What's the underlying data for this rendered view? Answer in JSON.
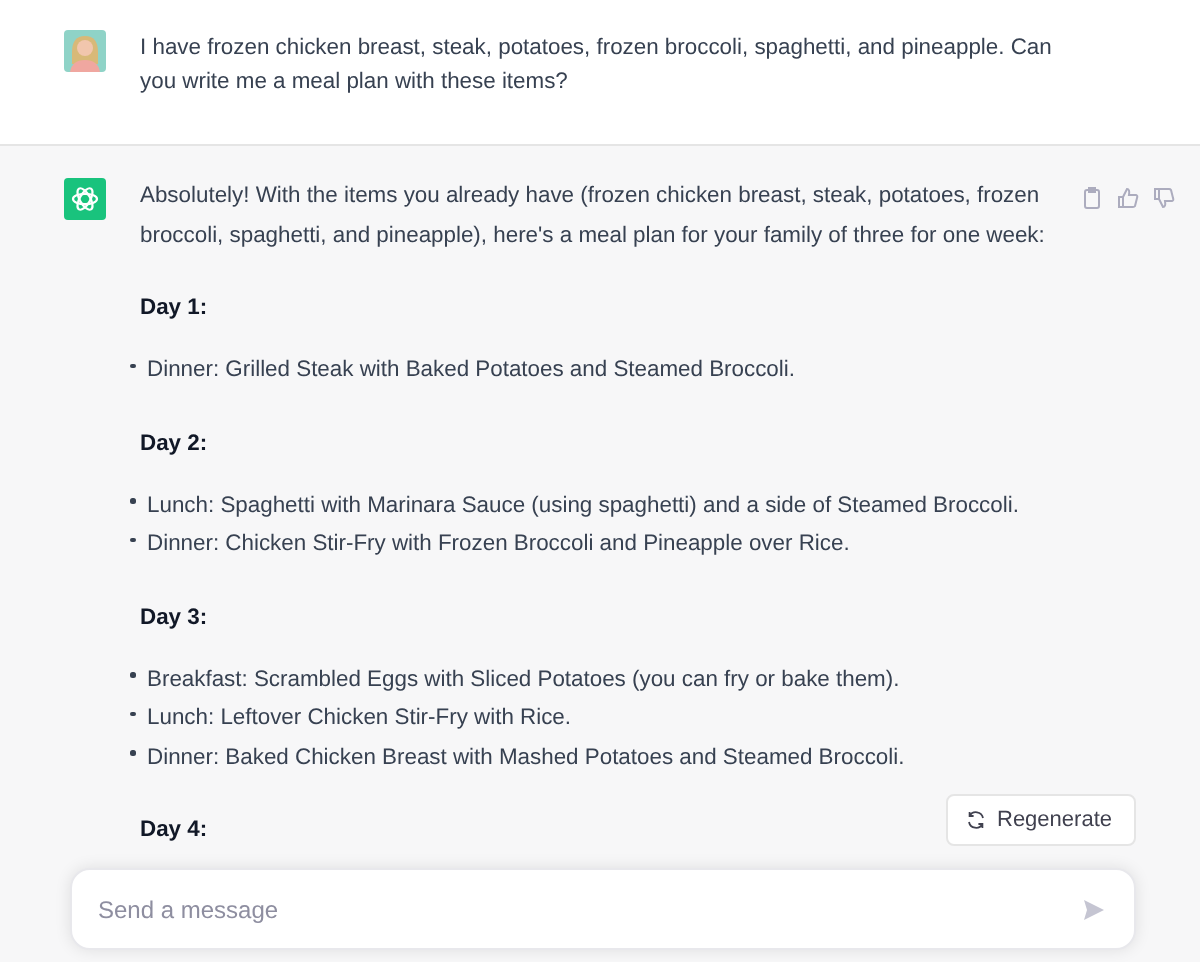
{
  "user_message": {
    "text": "I have frozen chicken breast, steak, potatoes, frozen broccoli, spaghetti, and pineapple. Can you write me a meal plan with these items?"
  },
  "assistant_message": {
    "intro": "Absolutely! With the items you already have (frozen chicken breast, steak, potatoes, frozen broccoli, spaghetti, and pineapple), here's a meal plan for your family of three for one week:",
    "days": [
      {
        "title": "Day 1:",
        "items": [
          "Dinner: Grilled Steak with Baked Potatoes and Steamed Broccoli."
        ]
      },
      {
        "title": "Day 2:",
        "items": [
          "Lunch: Spaghetti with Marinara Sauce (using spaghetti) and a side of Steamed Broccoli.",
          "Dinner: Chicken Stir-Fry with Frozen Broccoli and Pineapple over Rice."
        ]
      },
      {
        "title": "Day 3:",
        "items": [
          "Breakfast: Scrambled Eggs with Sliced Potatoes (you can fry or bake them).",
          "Lunch: Leftover Chicken Stir-Fry with Rice.",
          "Dinner: Baked Chicken Breast with Mashed Potatoes and Steamed Broccoli."
        ]
      },
      {
        "title": "Day 4:"
      }
    ]
  },
  "regenerate_button": {
    "label": "Regenerate"
  },
  "composer": {
    "placeholder": "Send a message"
  }
}
